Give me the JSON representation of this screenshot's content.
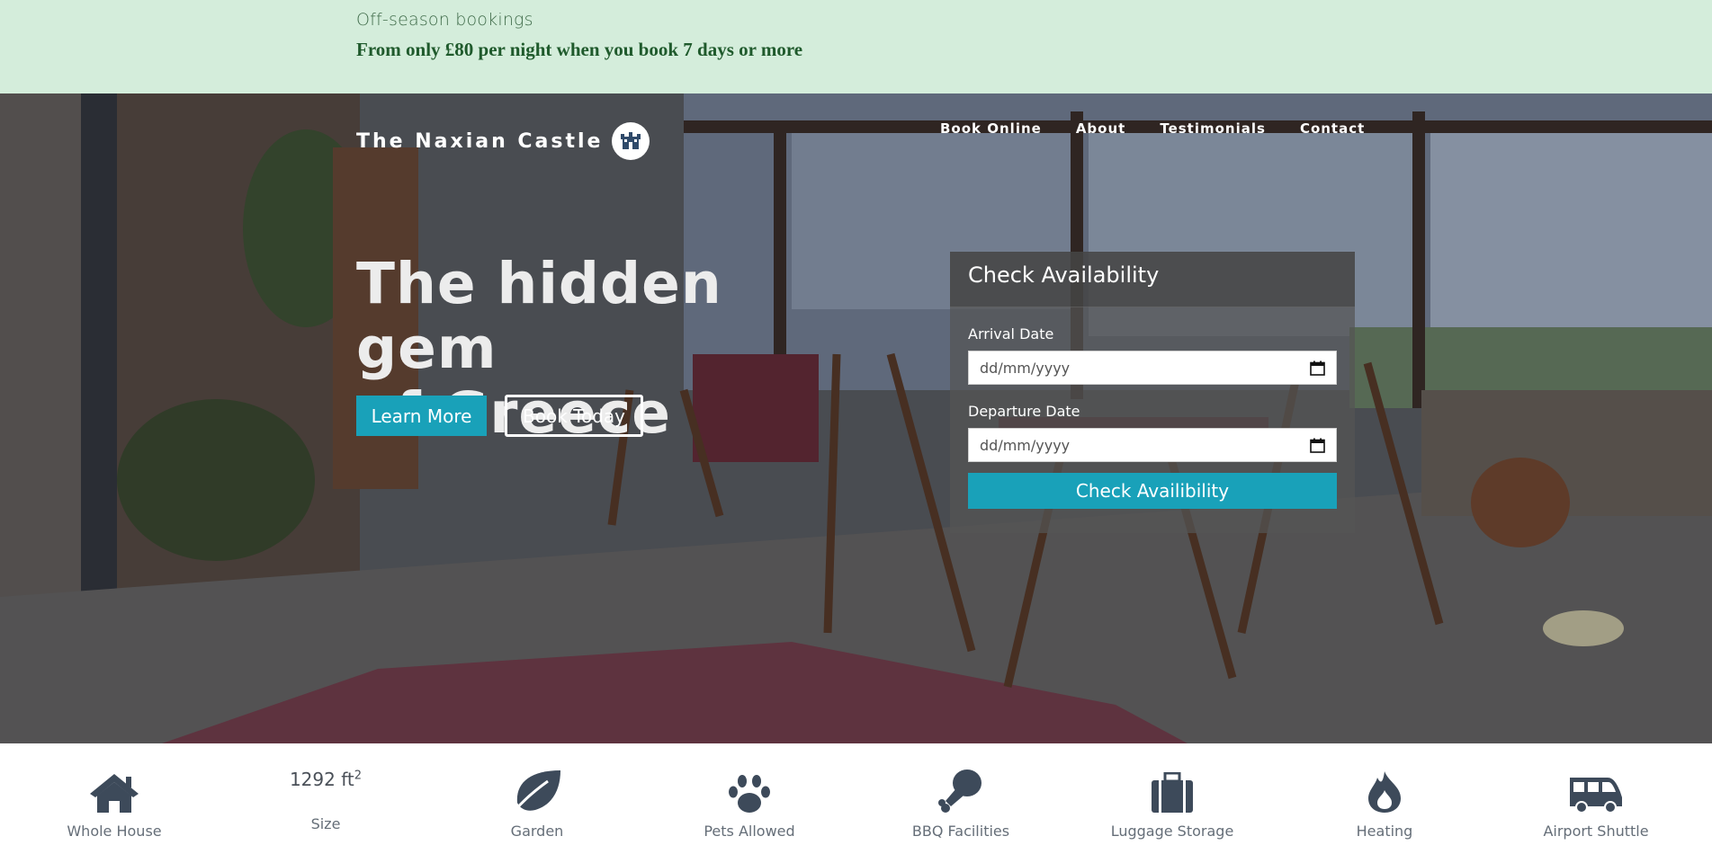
{
  "promo": {
    "heading": "Off-season bookings",
    "offer": "From only £80 per night when you book 7 days or more"
  },
  "brand": {
    "name": "The Naxian Castle",
    "logo_icon": "castle-logo-icon"
  },
  "nav": {
    "items": [
      "Book Online",
      "About",
      "Testimonials",
      "Contact"
    ]
  },
  "hero": {
    "headline_line1": "The hidden gem",
    "headline_line2": "of Greece",
    "learn_more_label": "Learn More",
    "book_today_label": "Book Today"
  },
  "availability": {
    "title": "Check Availability",
    "arrival_label": "Arrival Date",
    "arrival_placeholder": "dd/mm/yyyy",
    "departure_label": "Departure Date",
    "departure_placeholder": "dd/mm/yyyy",
    "submit_label": "Check Availibility"
  },
  "amenities": [
    {
      "icon": "home-icon",
      "label": "Whole House"
    },
    {
      "value": "1292 ft",
      "unit_sup": "2",
      "label": "Size"
    },
    {
      "icon": "leaf-icon",
      "label": "Garden"
    },
    {
      "icon": "paw-icon",
      "label": "Pets Allowed"
    },
    {
      "icon": "drumstick-icon",
      "label": "BBQ Facilities"
    },
    {
      "icon": "suitcase-icon",
      "label": "Luggage Storage"
    },
    {
      "icon": "fire-icon",
      "label": "Heating"
    },
    {
      "icon": "shuttle-van-icon",
      "label": "Airport Shuttle"
    }
  ],
  "colors": {
    "promo_bg": "#d4eddb",
    "accent": "#19a1b9",
    "icon": "#3d4a5a"
  }
}
